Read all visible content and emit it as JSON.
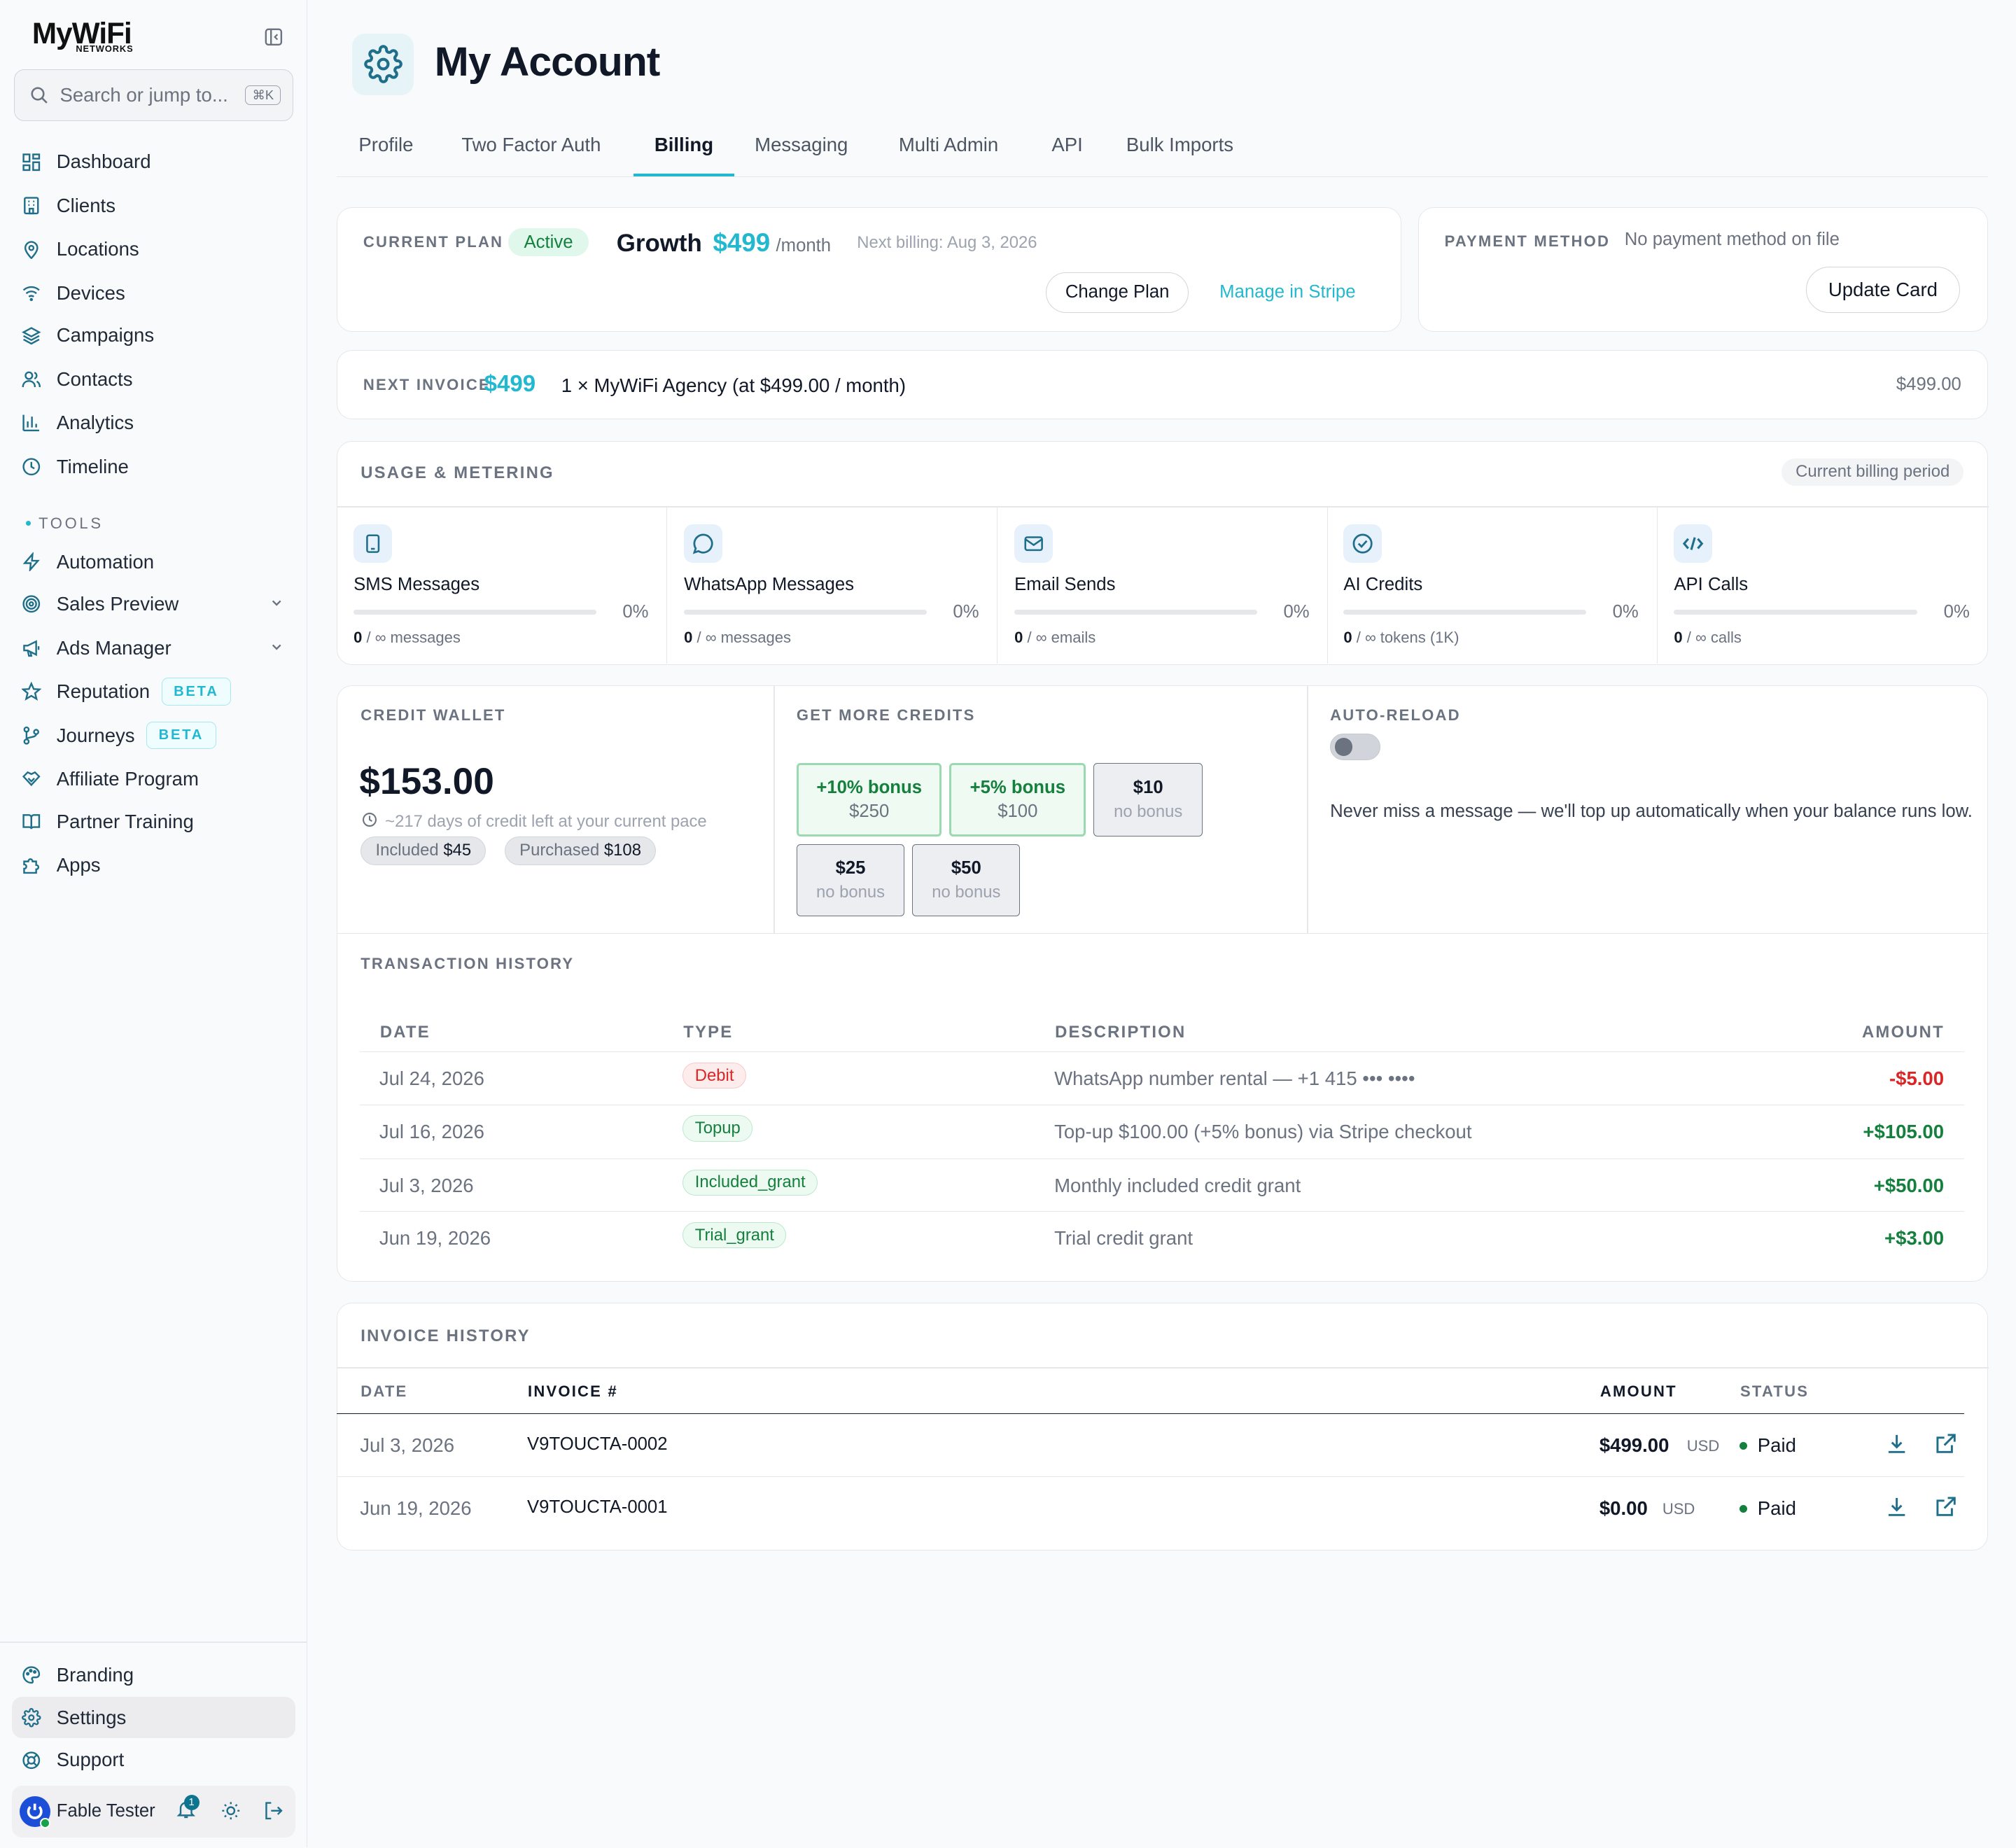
{
  "sidebar": {
    "logo_main": "MyWiFi",
    "logo_sub": "NETWORKS",
    "search_placeholder": "Search or jump to...",
    "search_shortcut": "⌘K",
    "nav": [
      {
        "label": "Dashboard",
        "icon": "dashboard-icon"
      },
      {
        "label": "Clients",
        "icon": "building-icon"
      },
      {
        "label": "Locations",
        "icon": "map-pin-icon"
      },
      {
        "label": "Devices",
        "icon": "wifi-icon"
      },
      {
        "label": "Campaigns",
        "icon": "layers-icon"
      },
      {
        "label": "Contacts",
        "icon": "users-icon"
      },
      {
        "label": "Analytics",
        "icon": "bar-chart-icon"
      },
      {
        "label": "Timeline",
        "icon": "clock-icon"
      }
    ],
    "tools_label": "TOOLS",
    "tools": [
      {
        "label": "Automation",
        "icon": "zap-icon"
      },
      {
        "label": "Sales Preview",
        "icon": "target-icon"
      },
      {
        "label": "Ads Manager",
        "icon": "megaphone-icon"
      },
      {
        "label": "Reputation",
        "icon": "star-icon",
        "badge": "BETA"
      },
      {
        "label": "Journeys",
        "icon": "git-branch-icon",
        "badge": "BETA"
      },
      {
        "label": "Affiliate Program",
        "icon": "handshake-icon"
      },
      {
        "label": "Partner Training",
        "icon": "book-icon"
      },
      {
        "label": "Apps",
        "icon": "puzzle-icon"
      }
    ],
    "bottom": [
      {
        "label": "Branding",
        "icon": "palette-icon"
      },
      {
        "label": "Settings",
        "icon": "gear-icon"
      },
      {
        "label": "Support",
        "icon": "life-buoy-icon"
      }
    ],
    "user_name": "Fable Tester",
    "notification_count": "1"
  },
  "header": {
    "title": "My Account",
    "tabs": [
      "Profile",
      "Two Factor Auth",
      "Billing",
      "Messaging",
      "Multi Admin",
      "API",
      "Bulk Imports"
    ],
    "active_tab": "Billing"
  },
  "plan": {
    "label": "CURRENT PLAN",
    "status": "Active",
    "name": "Growth",
    "price": "$499",
    "period": "/month",
    "next_billing": "Next billing: Aug 3, 2026",
    "change_plan": "Change Plan",
    "manage_stripe": "Manage in Stripe"
  },
  "payment": {
    "label": "PAYMENT METHOD",
    "value": "No payment method on file",
    "update_card": "Update Card"
  },
  "next_invoice": {
    "label": "NEXT INVOICE",
    "amount": "$499",
    "description": "1 × MyWiFi Agency (at $499.00 / month)",
    "total": "$499.00"
  },
  "usage": {
    "title": "USAGE & METERING",
    "period_badge": "Current billing period",
    "meters": [
      {
        "name": "SMS Messages",
        "icon": "phone-icon",
        "pct": "0%",
        "used": "0",
        "limit": "/ ∞ messages",
        "fill": 0
      },
      {
        "name": "WhatsApp Messages",
        "icon": "chat-bubble-icon",
        "pct": "0%",
        "used": "0",
        "limit": "/ ∞ messages",
        "fill": 0
      },
      {
        "name": "Email Sends",
        "icon": "mail-icon",
        "pct": "0%",
        "used": "0",
        "limit": "/ ∞ emails",
        "fill": 0
      },
      {
        "name": "AI Credits",
        "icon": "check-circle-icon",
        "pct": "0%",
        "used": "0",
        "limit": "/ ∞ tokens (1K)",
        "fill": 0
      },
      {
        "name": "API Calls",
        "icon": "code-icon",
        "pct": "0%",
        "used": "0",
        "limit": "/ ∞ calls",
        "fill": 0
      }
    ]
  },
  "wallet": {
    "label": "CREDIT WALLET",
    "balance": "$153.00",
    "days_left": "~217 days of credit left at your current pace",
    "included_label": "Included",
    "included_value": "$45",
    "purchased_label": "Purchased",
    "purchased_value": "$108"
  },
  "get_credits": {
    "label": "GET MORE CREDITS",
    "options": [
      {
        "top": "+10% bonus",
        "bottom": "$250"
      },
      {
        "top": "+5% bonus",
        "bottom": "$100"
      },
      {
        "top": "$10",
        "bottom": "no bonus"
      },
      {
        "top": "$25",
        "bottom": "no bonus"
      },
      {
        "top": "$50",
        "bottom": "no bonus"
      }
    ]
  },
  "auto_reload": {
    "label": "AUTO-RELOAD",
    "enabled": false,
    "text": "Never miss a message — we'll top up automatically when your balance runs low."
  },
  "transactions": {
    "title": "TRANSACTION HISTORY",
    "columns": [
      "DATE",
      "TYPE",
      "DESCRIPTION",
      "AMOUNT"
    ],
    "rows": [
      {
        "date": "Jul 24, 2026",
        "type": "Debit",
        "description": "WhatsApp number rental — +1 415 ••• ••••",
        "amount": "-$5.00"
      },
      {
        "date": "Jul 16, 2026",
        "type": "Topup",
        "description": "Top-up $100.00 (+5% bonus) via Stripe checkout",
        "amount": "+$105.00"
      },
      {
        "date": "Jul 3, 2026",
        "type": "Included_grant",
        "description": "Monthly included credit grant",
        "amount": "+$50.00"
      },
      {
        "date": "Jun 19, 2026",
        "type": "Trial_grant",
        "description": "Trial credit grant",
        "amount": "+$3.00"
      }
    ]
  },
  "invoices": {
    "title": "INVOICE HISTORY",
    "columns": [
      "DATE",
      "INVOICE #",
      "AMOUNT",
      "STATUS"
    ],
    "rows": [
      {
        "date": "Jul 3, 2026",
        "number": "V9TOUCTA-0002",
        "amount": "$499.00",
        "currency": "USD",
        "status": "Paid"
      },
      {
        "date": "Jun 19, 2026",
        "number": "V9TOUCTA-0001",
        "amount": "$0.00",
        "currency": "USD",
        "status": "Paid"
      }
    ]
  },
  "colors": {
    "accent": "#22b8cf",
    "teal_icon": "#1f6f8b",
    "positive": "#15803d",
    "negative": "#dc2626"
  }
}
